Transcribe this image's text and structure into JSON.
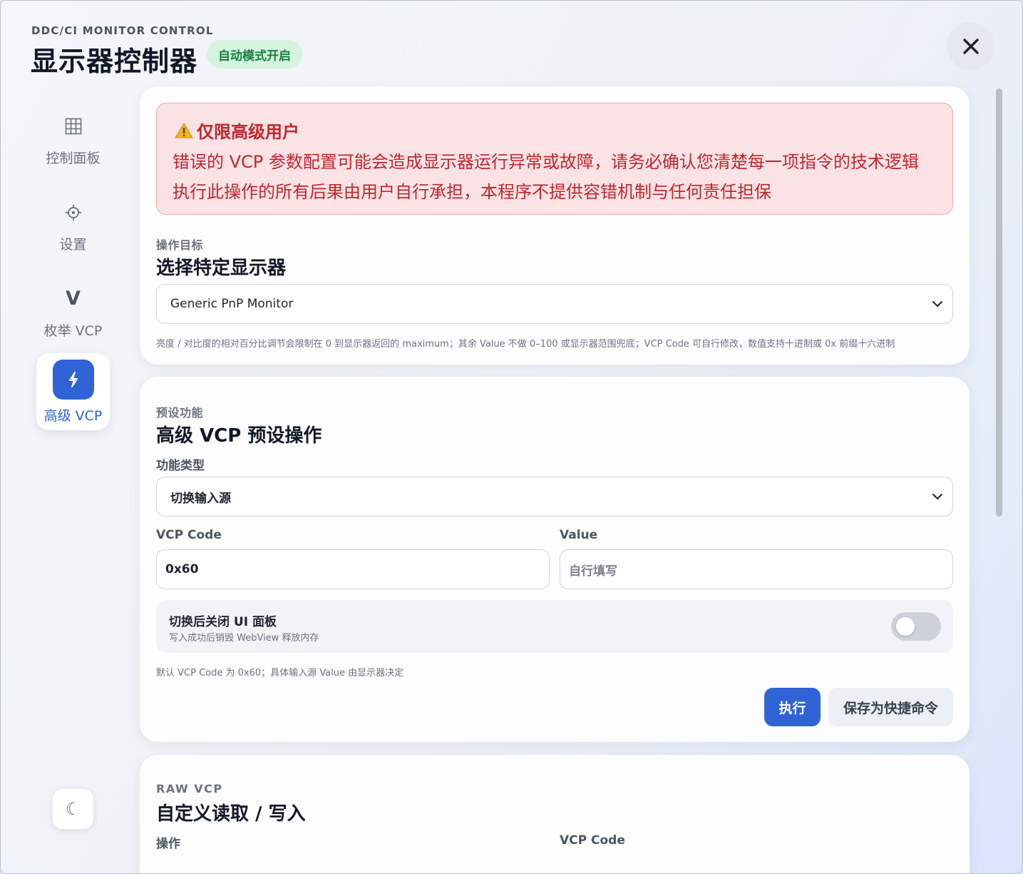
{
  "header": {
    "subtitle": "DDC/CI MONITOR CONTROL",
    "title": "显示器控制器",
    "badge": "自动模式开启"
  },
  "sidebar": {
    "items": [
      {
        "label": "控制面板",
        "icon": "grid-icon"
      },
      {
        "label": "设置",
        "icon": "gear-icon"
      },
      {
        "label": "枚举 VCP",
        "icon": "V",
        "icon_text": "V"
      },
      {
        "label": "高级 VCP",
        "icon": "lightning-icon",
        "active": true
      }
    ],
    "theme_icon": "☾"
  },
  "warning": {
    "title": "仅限高级用户",
    "line1": "错误的 VCP 参数配置可能会造成显示器运行异常或故障，请务必确认您清楚每一项指令的技术逻辑",
    "line2": "执行此操作的所有后果由用户自行承担，本程序不提供容错机制与任何责任担保"
  },
  "target": {
    "label": "操作目标",
    "title": "选择特定显示器",
    "selected_monitor": "Generic PnP Monitor",
    "hint": "亮度 / 对比度的相对百分比调节会限制在 0 到显示器返回的 maximum；其余 Value 不做 0–100 或显示器范围兜底；VCP Code 可自行修改，数值支持十进制或 0x 前缀十六进制"
  },
  "preset": {
    "label": "预设功能",
    "title": "高级 VCP 预设操作",
    "type_label": "功能类型",
    "type_value": "切换输入源",
    "vcp_label": "VCP Code",
    "vcp_value": "0x60",
    "value_label": "Value",
    "value_placeholder": "自行填写",
    "toggle_title": "切换后关闭 UI 面板",
    "toggle_desc": "写入成功后销毁 WebView 释放内存",
    "toggle_on": false,
    "hint": "默认 VCP Code 为 0x60；具体输入源 Value 由显示器决定",
    "execute_label": "执行",
    "save_label": "保存为快捷命令"
  },
  "raw": {
    "label": "RAW VCP",
    "title": "自定义读取 / 写入",
    "op_label": "操作",
    "vcp_label": "VCP Code"
  },
  "colors": {
    "accent": "#2f63d6",
    "badge_bg": "#d6f3df",
    "badge_text": "#15803d",
    "warning_bg": "#fbe3e5",
    "warning_text": "#c0262f"
  }
}
